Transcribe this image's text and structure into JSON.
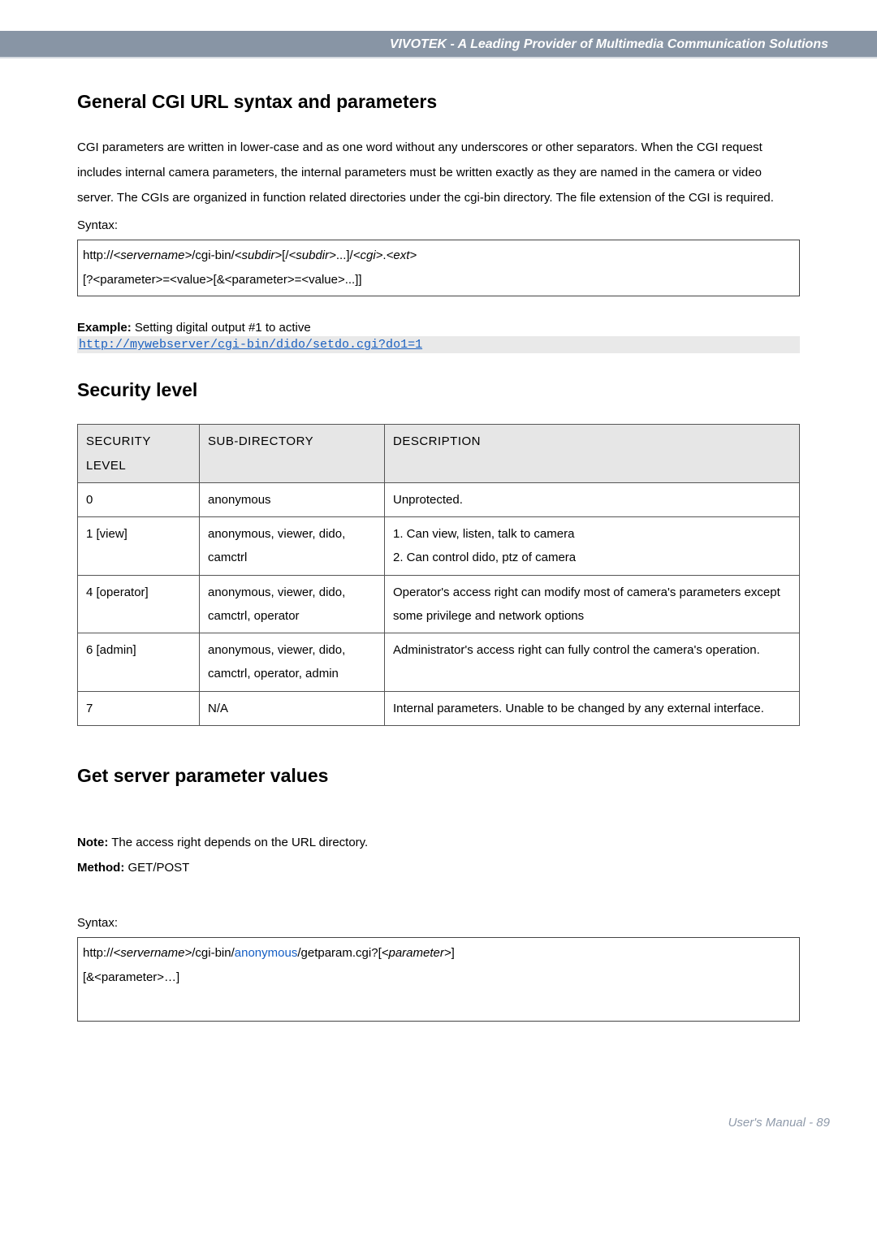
{
  "header": {
    "title": "VIVOTEK - A Leading Provider of Multimedia Communication Solutions"
  },
  "section1": {
    "heading": "General CGI URL syntax and parameters",
    "para": "CGI parameters are written in lower-case and as one word without any underscores or other separators. When the CGI request includes internal camera parameters, the internal parameters must be written exactly as they are named in the camera or video server. The CGIs are organized in function related directories under the cgi-bin directory. The file extension of the CGI is required.",
    "syntax_label": "Syntax:",
    "syntax_line1_a": "http://",
    "syntax_line1_b": "<servername>",
    "syntax_line1_c": "/cgi-bin/",
    "syntax_line1_d": "<subdir>",
    "syntax_line1_e": "[/",
    "syntax_line1_f": "<subdir>",
    "syntax_line1_g": "...]/",
    "syntax_line1_h": "<cgi>",
    "syntax_line1_i": ".",
    "syntax_line1_j": "<ext>",
    "syntax_line2": "[?<parameter>=<value>[&<parameter>=<value>...]]",
    "example_label": "Example:",
    "example_text": " Setting digital output #1 to active",
    "example_url": "http://mywebserver/cgi-bin/dido/setdo.cgi?do1=1"
  },
  "section2": {
    "heading": "Security level",
    "table": {
      "headers": {
        "c1": "SECURITY LEVEL",
        "c2": "SUB-DIRECTORY",
        "c3": "DESCRIPTION"
      },
      "rows": [
        {
          "level": "0",
          "subdir": "anonymous",
          "desc": "Unprotected."
        },
        {
          "level": "1 [view]",
          "subdir": "anonymous, viewer, dido, camctrl",
          "desc": "1. Can view, listen, talk to camera\n2. Can control dido, ptz of camera"
        },
        {
          "level": "4 [operator]",
          "subdir": "anonymous, viewer, dido, camctrl, operator",
          "desc": "Operator's access right can modify most of camera's parameters except some privilege and network options"
        },
        {
          "level": "6 [admin]",
          "subdir": "anonymous, viewer, dido, camctrl, operator, admin",
          "desc": "Administrator's access right can fully control the camera's operation."
        },
        {
          "level": "7",
          "subdir": "N/A",
          "desc": "Internal parameters. Unable to be changed by any external interface."
        }
      ]
    }
  },
  "section3": {
    "heading": "Get server parameter values",
    "note_label": "Note:",
    "note_text": " The access right depends on the URL directory.",
    "method_label": "Method:",
    "method_text": " GET/POST",
    "syntax_label": "Syntax:",
    "line1_a": "http://",
    "line1_b": "<servername>",
    "line1_c": "/cgi-bin/",
    "line1_d": "anonymous",
    "line1_e": "/getparam.cgi?[",
    "line1_f": "<parameter>",
    "line1_g": "]",
    "line2": "[&<parameter>…]"
  },
  "footer": {
    "text": "User's Manual - 89"
  }
}
